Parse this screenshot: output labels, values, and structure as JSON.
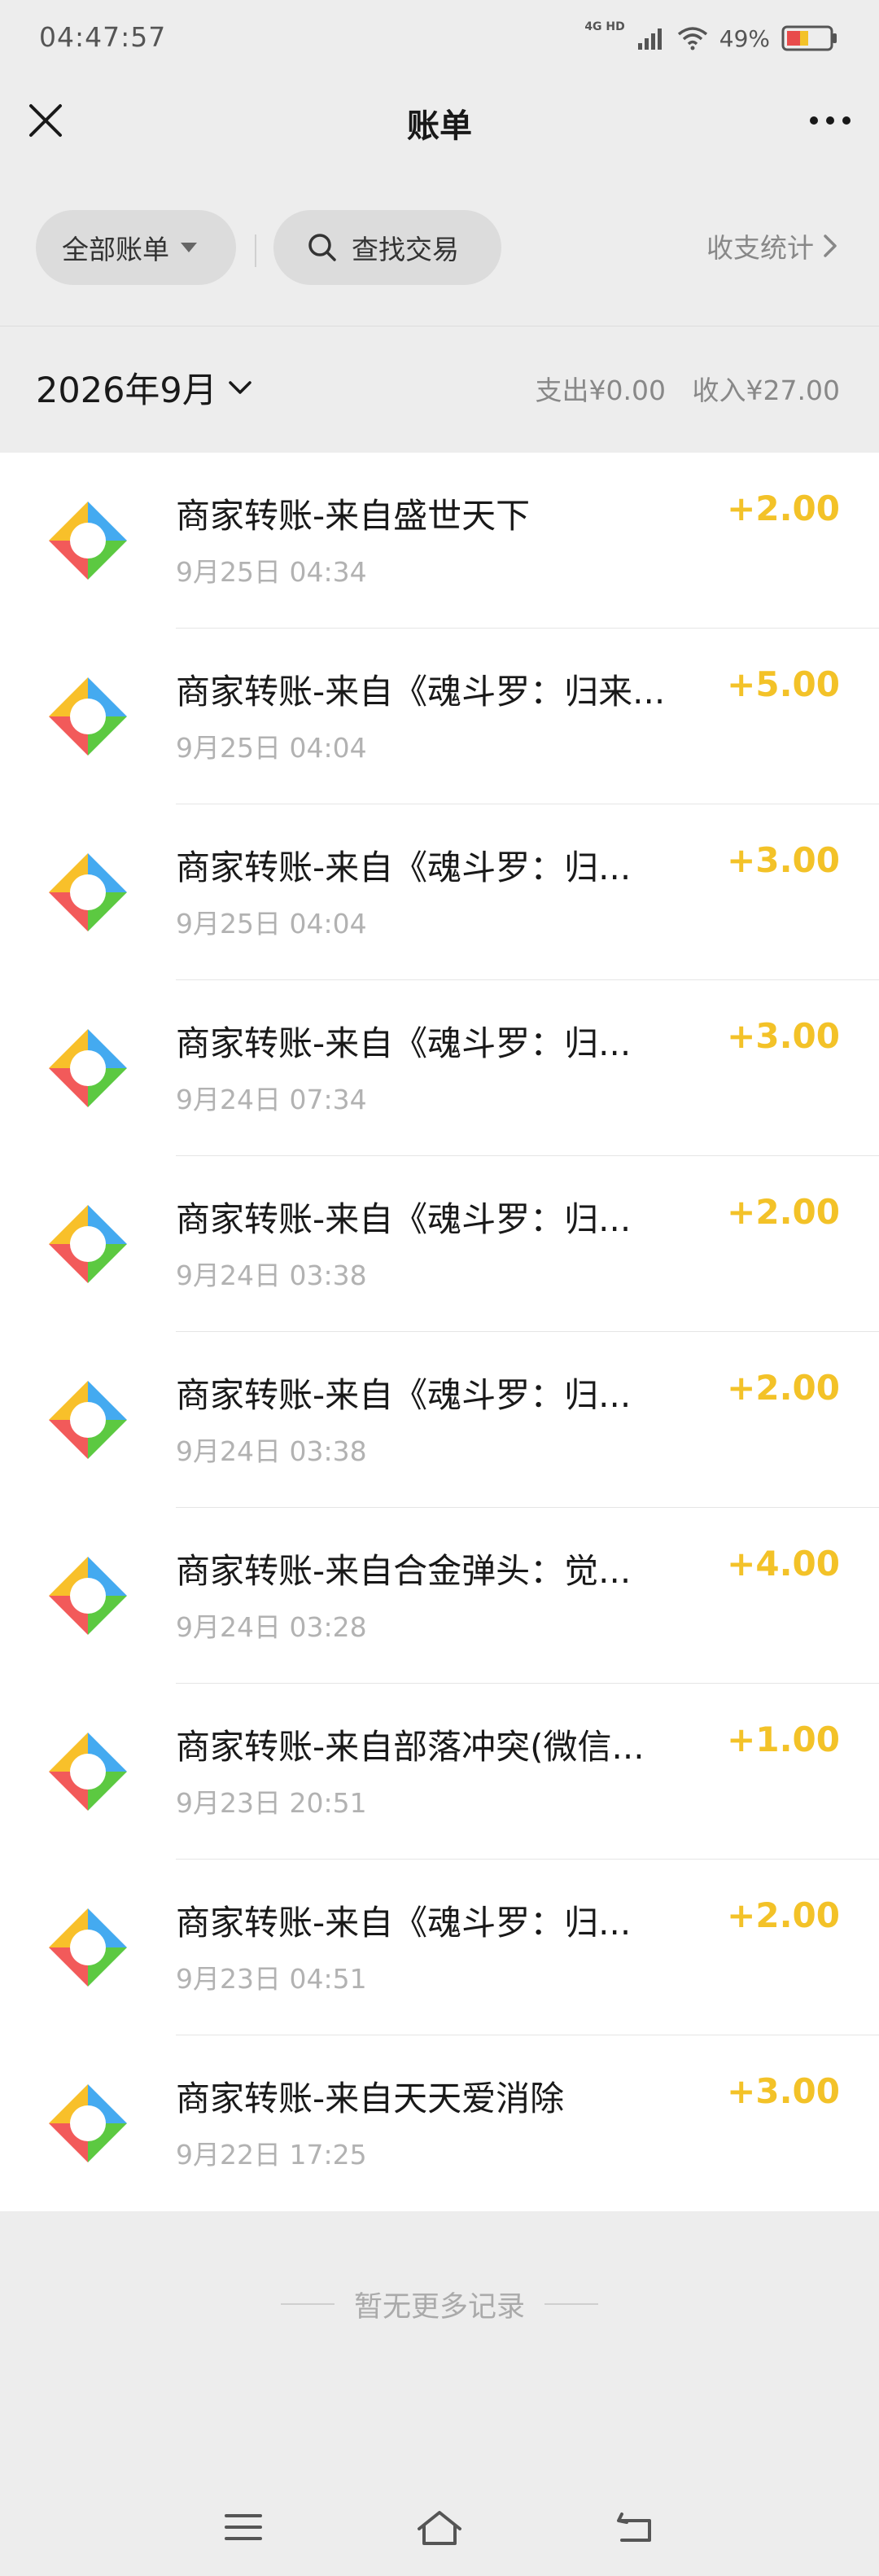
{
  "status_bar": {
    "time": "04:47:57",
    "network": "4G HD",
    "battery": "49%"
  },
  "header": {
    "title": "账单"
  },
  "filters": {
    "all_bills": "全部账单",
    "search": "查找交易",
    "stats": "收支统计"
  },
  "month": {
    "label": "2026年9月",
    "expense": "支出¥0.00",
    "income": "收入¥27.00"
  },
  "transactions": [
    {
      "title": "商家转账-来自盛世天下",
      "date": "9月25日 04:34",
      "amount": "+2.00"
    },
    {
      "title": "商家转账-来自《魂斗罗：归来...",
      "date": "9月25日 04:04",
      "amount": "+5.00"
    },
    {
      "title": "商家转账-来自《魂斗罗：归...",
      "date": "9月25日 04:04",
      "amount": "+3.00"
    },
    {
      "title": "商家转账-来自《魂斗罗：归...",
      "date": "9月24日 07:34",
      "amount": "+3.00"
    },
    {
      "title": "商家转账-来自《魂斗罗：归...",
      "date": "9月24日 03:38",
      "amount": "+2.00"
    },
    {
      "title": "商家转账-来自《魂斗罗：归...",
      "date": "9月24日 03:38",
      "amount": "+2.00"
    },
    {
      "title": "商家转账-来自合金弹头：觉...",
      "date": "9月24日 03:28",
      "amount": "+4.00"
    },
    {
      "title": "商家转账-来自部落冲突(微信...",
      "date": "9月23日 20:51",
      "amount": "+1.00"
    },
    {
      "title": "商家转账-来自《魂斗罗：归...",
      "date": "9月23日 04:51",
      "amount": "+2.00"
    },
    {
      "title": "商家转账-来自天天爱消除",
      "date": "9月22日 17:25",
      "amount": "+3.00"
    }
  ],
  "footer": {
    "end_note": "暂无更多记录"
  },
  "colors": {
    "amount": "#f3c228",
    "background": "#ededed"
  },
  "icons": {
    "transaction_logo": "merchant-pinwheel-icon",
    "close": "close-icon",
    "more": "more-icon",
    "search": "search-icon",
    "menu": "menu-icon",
    "home": "home-icon",
    "back": "back-icon"
  }
}
